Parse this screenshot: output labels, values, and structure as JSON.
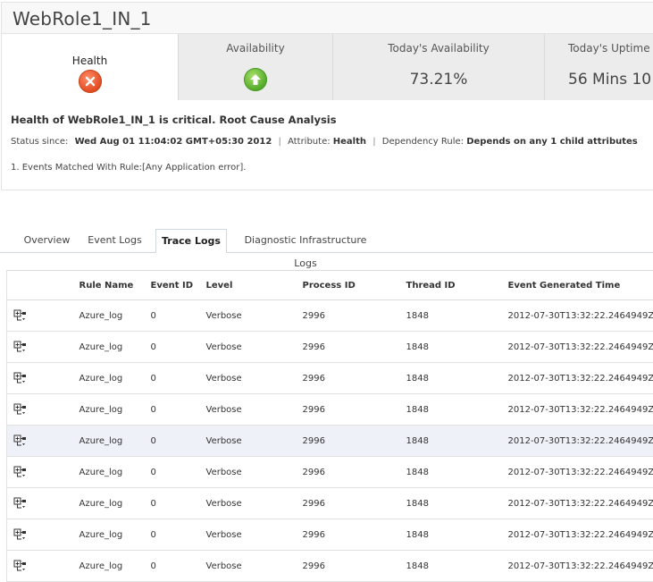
{
  "page": {
    "title": "WebRole1_IN_1"
  },
  "metrics": {
    "health": {
      "label": "Health",
      "icon": "critical-x-icon",
      "status_color": "#e04a1f"
    },
    "availability": {
      "label": "Availability",
      "icon": "up-arrow-icon",
      "status_color": "#4fa828"
    },
    "today_availability": {
      "label": "Today's Availability",
      "value": "73.21%"
    },
    "today_uptime": {
      "label": "Today's Uptime",
      "value": "56 Mins 10"
    }
  },
  "rca": {
    "heading": "Health of WebRole1_IN_1 is critical. Root Cause Analysis",
    "status_since_label": "Status since:",
    "status_since_value": "Wed Aug 01 11:04:02 GMT+05:30 2012",
    "attribute_label": "Attribute:",
    "attribute_value": "Health",
    "dependency_label": "Dependency Rule:",
    "dependency_value": "Depends on any 1 child attributes",
    "events": "1. Events Matched With Rule:[Any Application error]."
  },
  "tabs": [
    {
      "label": "Overview"
    },
    {
      "label": "Event Logs"
    },
    {
      "label": "Trace Logs"
    },
    {
      "label": "Diagnostic Infrastructure Logs"
    }
  ],
  "active_tab": "Trace Logs",
  "table": {
    "columns": [
      "Rule Name",
      "Event ID",
      "Level",
      "Process ID",
      "Thread ID",
      "Event Generated Time"
    ],
    "rows": [
      [
        "Azure_log",
        "0",
        "Verbose",
        "2996",
        "1848",
        "2012-07-30T13:32:22.2464949Z"
      ],
      [
        "Azure_log",
        "0",
        "Verbose",
        "2996",
        "1848",
        "2012-07-30T13:32:22.2464949Z"
      ],
      [
        "Azure_log",
        "0",
        "Verbose",
        "2996",
        "1848",
        "2012-07-30T13:32:22.2464949Z"
      ],
      [
        "Azure_log",
        "0",
        "Verbose",
        "2996",
        "1848",
        "2012-07-30T13:32:22.2464949Z"
      ],
      [
        "Azure_log",
        "0",
        "Verbose",
        "2996",
        "1848",
        "2012-07-30T13:32:22.2464949Z"
      ],
      [
        "Azure_log",
        "0",
        "Verbose",
        "2996",
        "1848",
        "2012-07-30T13:32:22.2464949Z"
      ],
      [
        "Azure_log",
        "0",
        "Verbose",
        "2996",
        "1848",
        "2012-07-30T13:32:22.2464949Z"
      ],
      [
        "Azure_log",
        "0",
        "Verbose",
        "2996",
        "1848",
        "2012-07-30T13:32:22.2464949Z"
      ],
      [
        "Azure_log",
        "0",
        "Verbose",
        "2996",
        "1848",
        "2012-07-30T13:32:22.2464949Z"
      ]
    ],
    "highlighted_row": 4,
    "row_icon": "tree-expand-icon"
  }
}
